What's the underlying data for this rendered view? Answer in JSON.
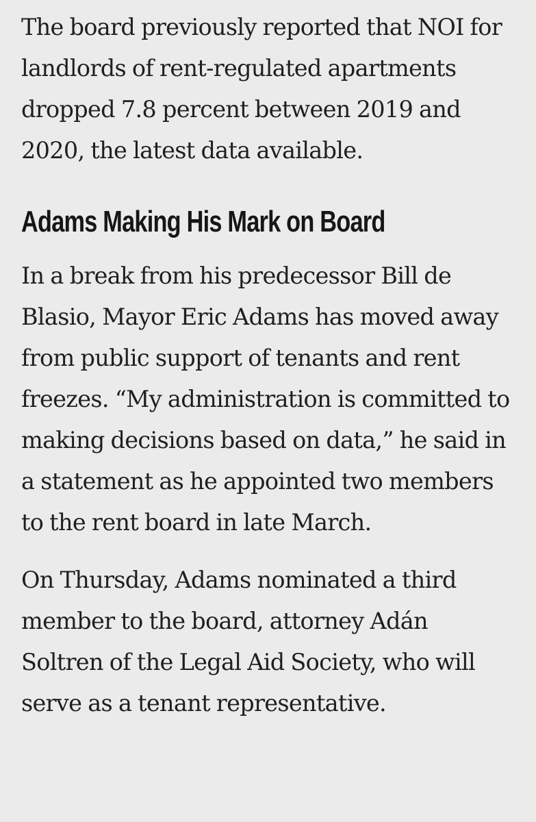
{
  "article": {
    "paragraph_1": "The board previously reported that NOI for landlords of rent-regulated apartments dropped 7.8 percent between 2019 and 2020, the latest data available.",
    "heading": "Adams Making His Mark on Board",
    "paragraph_2": "In a break from his predecessor Bill de Blasio, Mayor Eric Adams has moved away from public support of tenants and rent freezes. “My administration is committed to making decisions based on data,” he said in a statement as he appointed two members to the rent board in late March.",
    "paragraph_3": "On Thursday, Adams nominated a third member to the board, attorney Adán Soltren of the Legal Aid Society, who will serve as a tenant representative."
  }
}
